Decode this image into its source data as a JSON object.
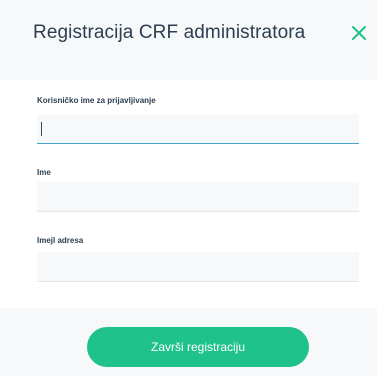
{
  "modal": {
    "title": "Registracija CRF administratora",
    "close_icon": "close-icon"
  },
  "fields": [
    {
      "label": "Korisničko ime za prijavljivanje",
      "value": "",
      "placeholder": "",
      "focused": true
    },
    {
      "label": "Ime",
      "value": "",
      "placeholder": ""
    },
    {
      "label": "Imejl adresa",
      "value": "",
      "placeholder": ""
    }
  ],
  "footer": {
    "submit_label": "Završi registraciju"
  },
  "colors": {
    "accent": "#1fc28a",
    "close_icon": "#1fc28a",
    "focus_underline": "#4aa3c9",
    "text": "#2c3e50",
    "field_background": "#f7f8fa"
  }
}
